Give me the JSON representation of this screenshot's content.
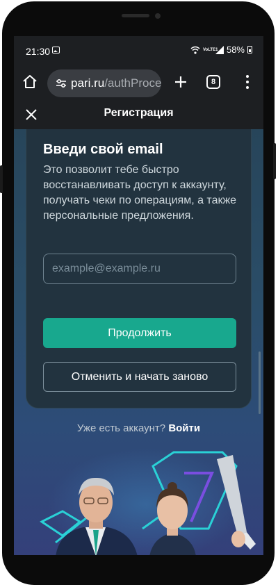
{
  "status_bar": {
    "time": "21:30",
    "network_label": "VoLTE1",
    "battery": "58%"
  },
  "browser": {
    "url_host": "pari.ru",
    "url_path": "/authProce",
    "tab_count": "8"
  },
  "header": {
    "title": "Регистрация"
  },
  "form": {
    "heading": "Введи свой email",
    "description": "Это позволит тебе быстро восстанавливать доступ к аккаунту, получать чеки по операциям, а также персональные предложения.",
    "email_value": "",
    "email_placeholder": "example@example.ru",
    "continue_label": "Продолжить",
    "restart_label": "Отменить и начать заново"
  },
  "login": {
    "prompt": "Уже есть аккаунт?",
    "link": "Войти"
  },
  "colors": {
    "accent": "#18a88e",
    "card_bg": "#22333f",
    "promo_neon": "#2ad1d6"
  }
}
